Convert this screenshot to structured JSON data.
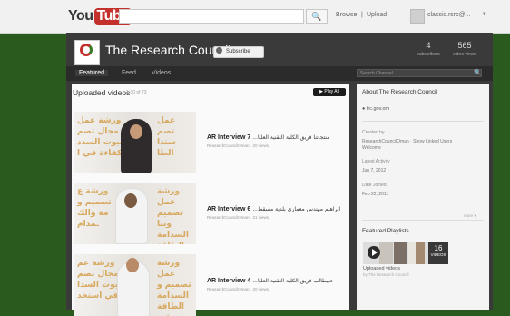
{
  "topbar": {
    "logo_you": "You",
    "logo_tube": "Tube",
    "search_placeholder": "",
    "browse": "Browse",
    "upload": "Upload",
    "user": "classic.rsrc@..."
  },
  "channel": {
    "name": "The Research Council",
    "subscribe_label": "Subscribe",
    "stats": [
      {
        "value": "4",
        "label": "subscribers"
      },
      {
        "value": "565",
        "label": "video views"
      }
    ],
    "tabs": [
      "Featured",
      "Feed",
      "Videos"
    ],
    "search_placeholder": "Search Channel"
  },
  "main": {
    "section_title": "Uploaded videos",
    "section_count": "1-30 of 73",
    "play_all": "▶ Play All",
    "videos": [
      {
        "title": "AR Interview 7",
        "arabic": "...منتجاتنا فريق الكلية التقنية العليا",
        "meta": "ResearchCouncilOman · 20 views"
      },
      {
        "title": "AR Interview 6",
        "arabic": "...ابراهيم مهندس معماري بلدية مسقط",
        "meta": "ResearchCouncilOman · 21 views"
      },
      {
        "title": "AR Interview 4",
        "arabic": "...عليطالب فريق الكلية التقنية العليا",
        "meta": "ResearchCouncilOman · 20 views"
      }
    ]
  },
  "sidebar": {
    "about_title": "About The Research Council",
    "website": "trc.gov.om",
    "created_by_label": "Created by",
    "created_by_value": "ResearchCouncilOman · Show Linked Users",
    "created_by_extra": "Welcome",
    "latest_label": "Latest Activity",
    "latest_value": "Jun 7, 2012",
    "joined_label": "Date Joined",
    "joined_value": "Feb 22, 2011",
    "more": "more",
    "playlists_title": "Featured Playlists",
    "playlist_count": "16",
    "playlist_count_word": "VIDEOS",
    "playlist_name": "Uploaded videos",
    "playlist_by": "by The Research Council"
  },
  "colors": {
    "youtube_red": "#c4302b",
    "page_bg": "#2a5a1e"
  }
}
